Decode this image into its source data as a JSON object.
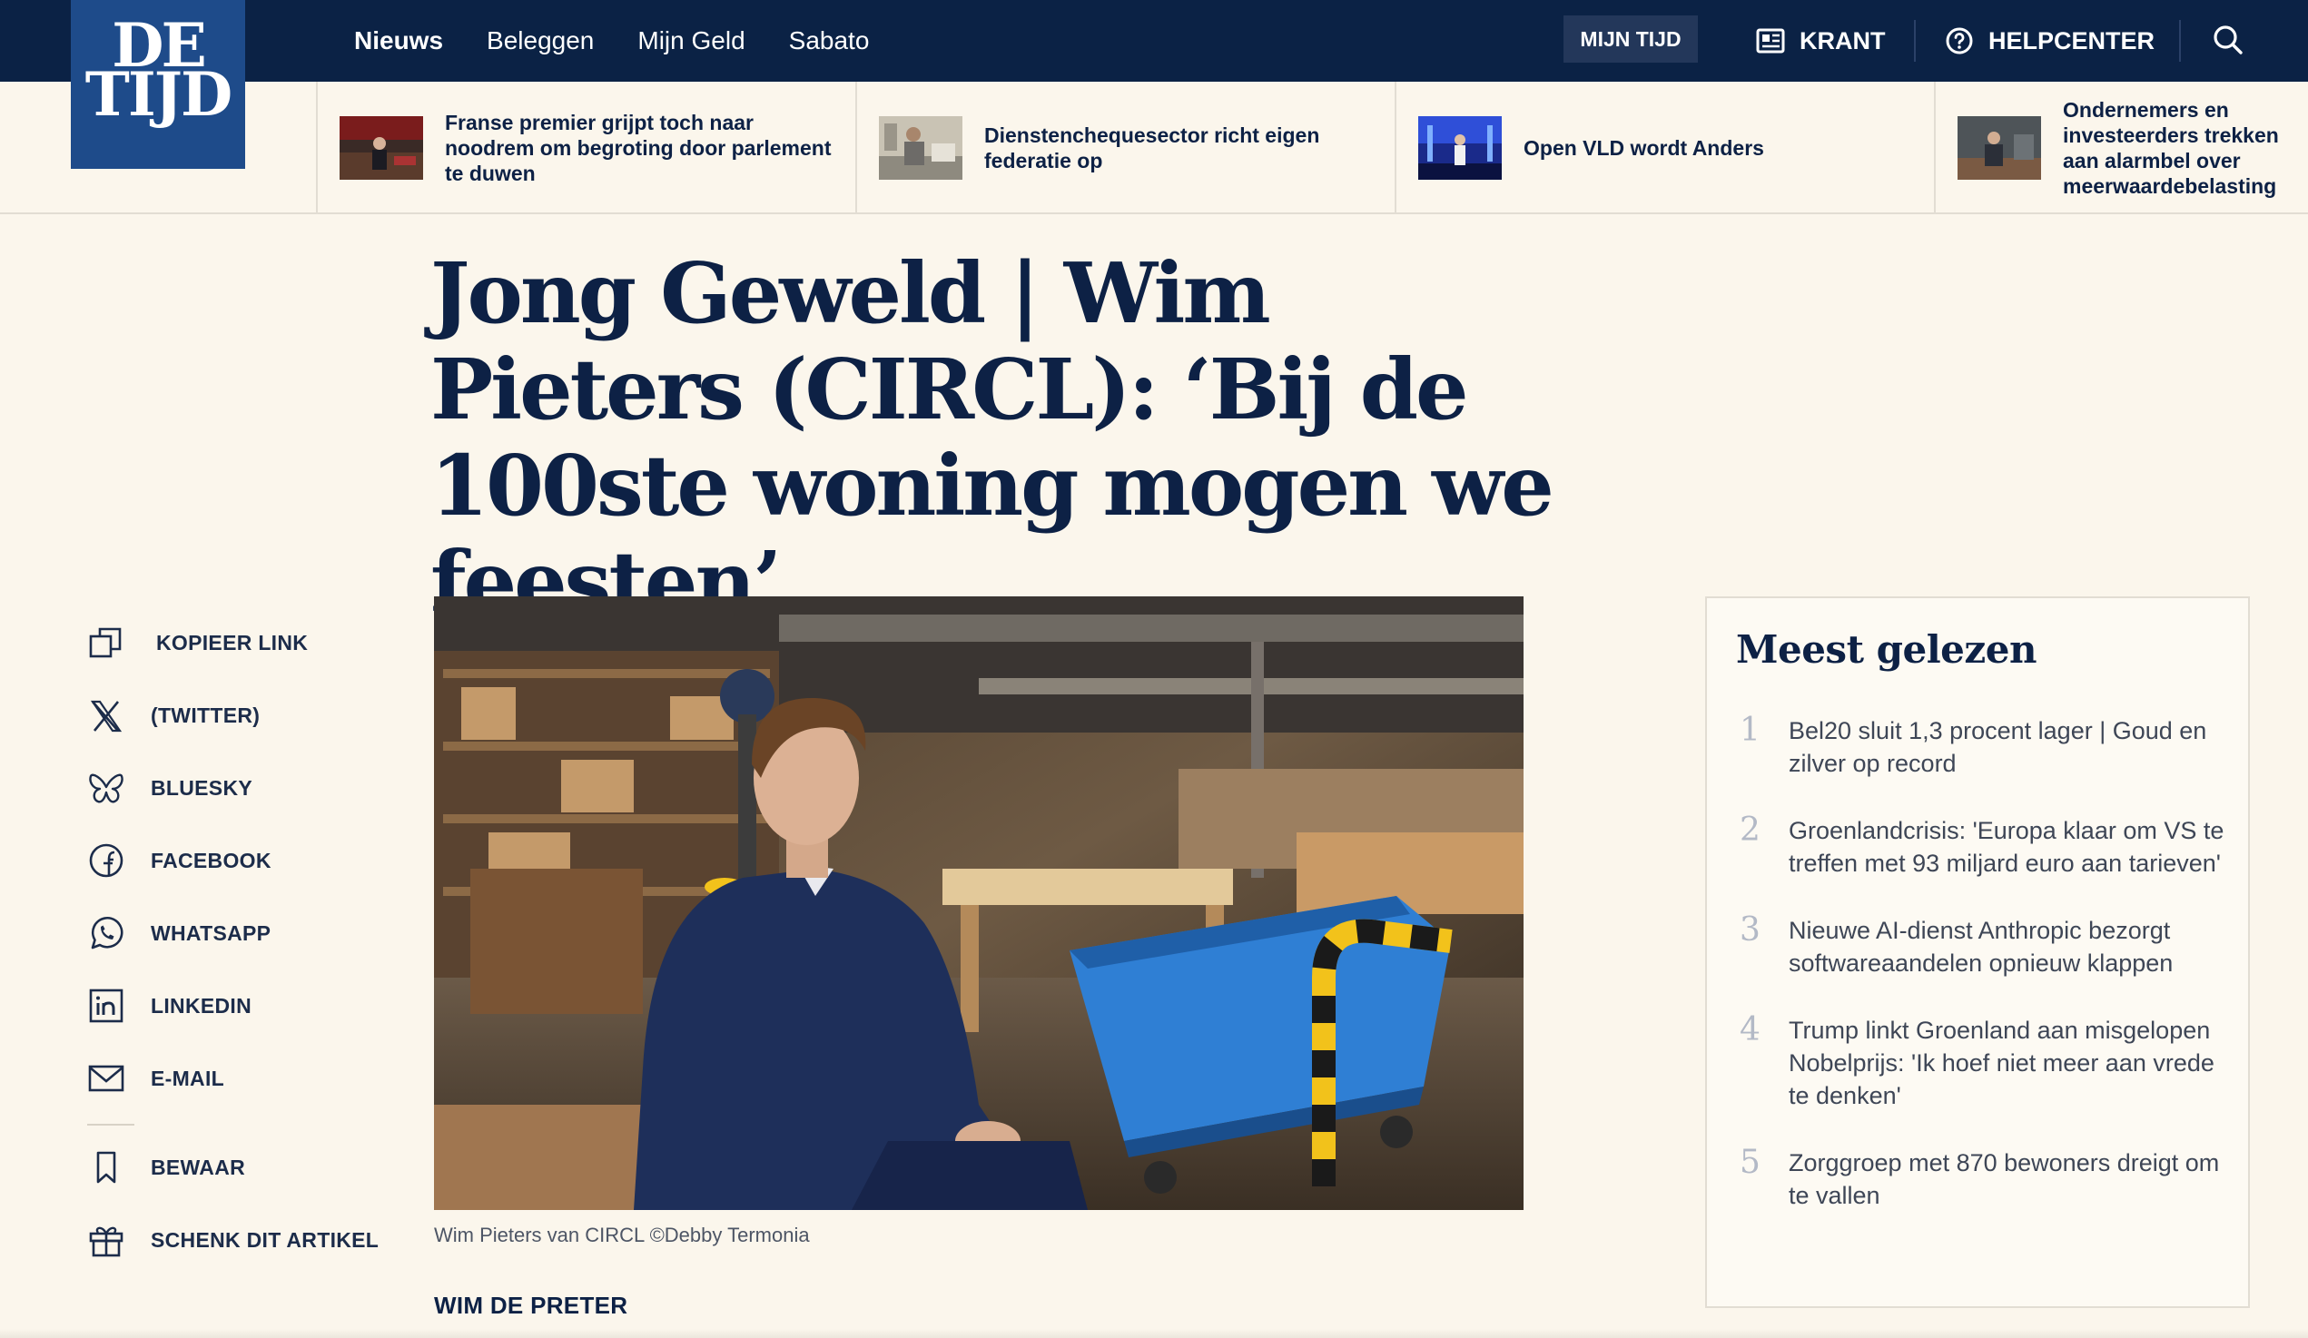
{
  "logo": {
    "line1": "DE",
    "line2": "TIJD"
  },
  "nav": {
    "links": [
      "Nieuws",
      "Beleggen",
      "Mijn Geld",
      "Sabato"
    ],
    "mijn_tijd": "MIJN TIJD",
    "krant": "KRANT",
    "helpcenter": "HELPCENTER"
  },
  "headlines": [
    {
      "text": "Franse premier grijpt toch naar noodrem om begroting door parlement te duwen",
      "thumb": "parliament-photo"
    },
    {
      "text": "Dienstenchequesector richt eigen federatie op",
      "thumb": "cleaning-photo"
    },
    {
      "text": "Open VLD wordt Anders",
      "thumb": "stage-photo"
    },
    {
      "text": "Ondernemers en investeerders trekken aan alarmbel over meerwaardebelasting",
      "thumb": "speaker-photo"
    }
  ],
  "article": {
    "title": "Jong Geweld | Wim Pieters (CIRCL): ‘Bij de 100ste woning mogen we feesten’",
    "image_caption": "Wim Pieters van CIRCL ©Debby Termonia",
    "author": "WIM DE PRETER"
  },
  "share": {
    "copy_link": "KOPIEER LINK",
    "twitter": "(TWITTER)",
    "bluesky": "BLUESKY",
    "facebook": "FACEBOOK",
    "whatsapp": "WHATSAPP",
    "linkedin": "LINKEDIN",
    "email": "E-MAIL",
    "save": "BEWAAR",
    "gift": "SCHENK DIT ARTIKEL"
  },
  "most_read": {
    "title": "Meest gelezen",
    "items": [
      {
        "num": "1",
        "text": "Bel20 sluit 1,3 procent lager | Goud en zilver op record"
      },
      {
        "num": "2",
        "text": "Groenlandcrisis: 'Europa klaar om VS te treffen met 93 miljard euro aan tarieven'"
      },
      {
        "num": "3",
        "text": "Nieuwe AI-dienst Anthropic bezorgt softwareaandelen opnieuw klappen"
      },
      {
        "num": "4",
        "text": "Trump linkt Groenland aan misgelopen Nobelprijs: 'Ik hoef niet meer aan vrede te denken'"
      },
      {
        "num": "5",
        "text": "Zorggroep met 870 bewoners dreigt om te vallen"
      }
    ]
  },
  "colors": {
    "navy": "#0b2245",
    "logo_blue": "#1e4b8a",
    "page_bg": "#fbf6ec"
  }
}
